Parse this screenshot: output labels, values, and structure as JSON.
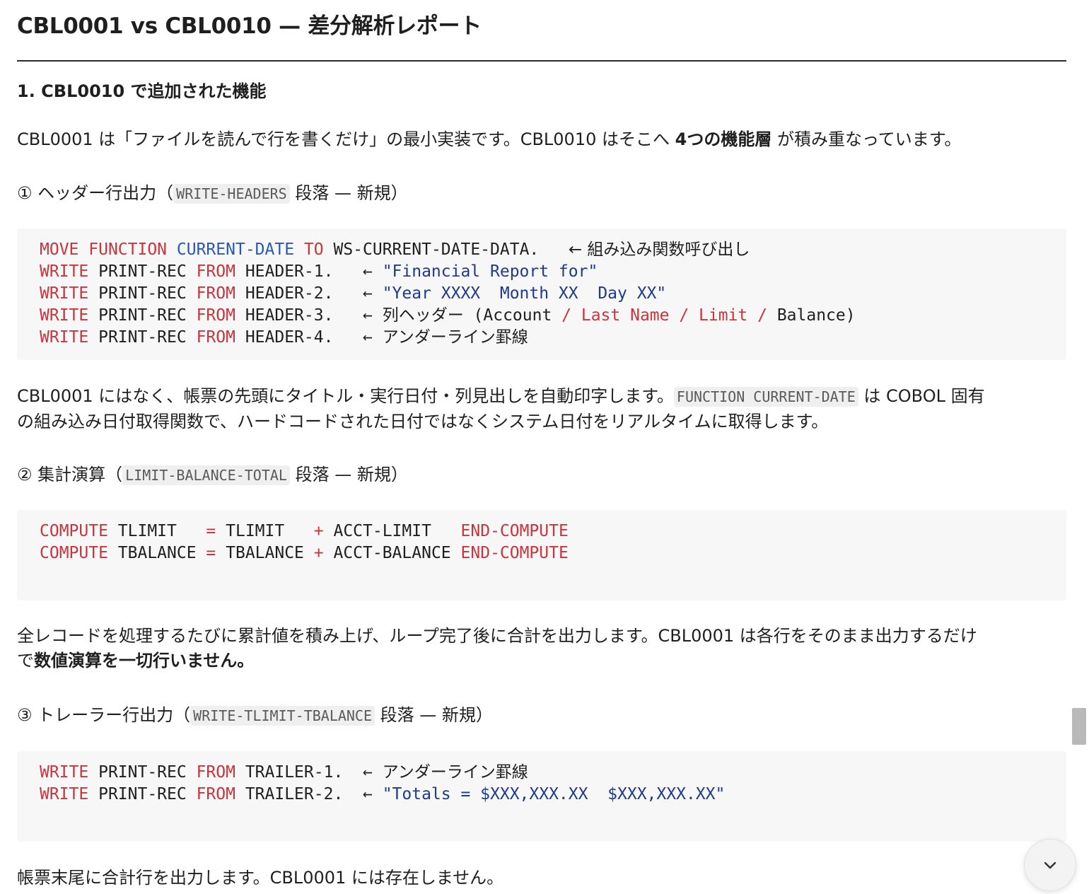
{
  "title": "CBL0001 vs CBL0010 — 差分解析レポート",
  "section1": {
    "heading": "1. CBL0010 で追加された機能",
    "intro_a": "CBL0001 は「ファイルを読んで行を書くだけ」の最小実装です。CBL0010 はそこへ ",
    "intro_b": "4つの機能層",
    "intro_c": " が積み重なっています。"
  },
  "feature1": {
    "h_prefix": "① ヘッダー行出力（",
    "h_code": "WRITE-HEADERS",
    "h_suffix": " 段落 — 新規）",
    "code": [
      {
        "a": "MOVE",
        "b": "FUNCTION",
        "c": "CURRENT-DATE",
        "d": "TO",
        "e": " WS-CURRENT-DATE-DATA.   ",
        "f": "← 組み込み関数呼び出し"
      },
      {
        "a": "WRITE",
        "b": " PRINT-REC ",
        "c": "FROM",
        "d": " HEADER-1.   ← ",
        "e": "\"Financial Report for\""
      },
      {
        "a": "WRITE",
        "b": " PRINT-REC ",
        "c": "FROM",
        "d": " HEADER-2.   ← ",
        "e": "\"Year XXXX  Month XX  Day XX\""
      },
      {
        "a": "WRITE",
        "b": " PRINT-REC ",
        "c": "FROM",
        "d": " HEADER-3.   ← ",
        "e": "列ヘッダー (Account ",
        "f": "/ Last Name / Limit /",
        "g": " Balance)"
      },
      {
        "a": "WRITE",
        "b": " PRINT-REC ",
        "c": "FROM",
        "d": " HEADER-4.   ← ",
        "e": "アンダーライン罫線"
      }
    ],
    "desc_a": "CBL0001 にはなく、帳票の先頭にタイトル・実行日付・列見出しを自動印字します。",
    "desc_code": "FUNCTION CURRENT-DATE",
    "desc_b": " は COBOL 固有",
    "desc_c": "の組み込み日付取得関数で、ハードコードされた日付ではなくシステム日付をリアルタイムに取得します。"
  },
  "feature2": {
    "h_prefix": "② 集計演算（",
    "h_code": "LIMIT-BALANCE-TOTAL",
    "h_suffix": " 段落 — 新規）",
    "code": [
      {
        "a": "COMPUTE",
        "b": " TLIMIT   ",
        "c": "=",
        "d": " TLIMIT   ",
        "e": "+",
        "f": " ACCT-LIMIT   ",
        "g": "END-COMPUTE"
      },
      {
        "a": "COMPUTE",
        "b": " TBALANCE ",
        "c": "=",
        "d": " TBALANCE ",
        "e": "+",
        "f": " ACCT-BALANCE ",
        "g": "END-COMPUTE"
      }
    ],
    "desc_a": "全レコードを処理するたびに累計値を積み上げ、ループ完了後に合計を出力します。CBL0001 は各行をそのまま出力するだけ",
    "desc_b": "で",
    "desc_c": "数値演算を一切行いません。"
  },
  "feature3": {
    "h_prefix": "③ トレーラー行出力（",
    "h_code": "WRITE-TLIMIT-TBALANCE",
    "h_suffix": " 段落 — 新規）",
    "code": [
      {
        "a": "WRITE",
        "b": " PRINT-REC ",
        "c": "FROM",
        "d": " TRAILER-1.  ← ",
        "e": "アンダーライン罫線"
      },
      {
        "a": "WRITE",
        "b": " PRINT-REC ",
        "c": "FROM",
        "d": " TRAILER-2.  ← ",
        "e": "\"Totals = $XXX,XXX.XX  $XXX,XXX.XX\""
      }
    ],
    "desc": "帳票末尾に合計行を出力します。CBL0001 には存在しません。"
  },
  "scroll_button_icon": "chevron-down-icon"
}
